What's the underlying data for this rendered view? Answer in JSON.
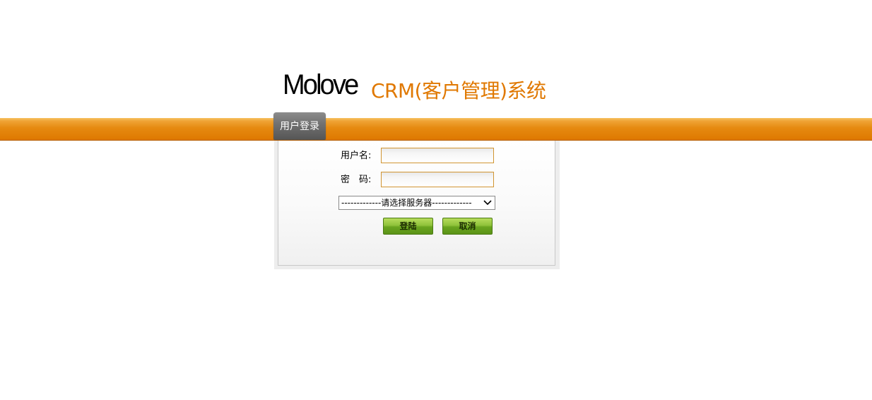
{
  "header": {
    "logo_text": "Molove",
    "app_title": "CRM(客户管理)系统"
  },
  "tab": {
    "label": "用户登录"
  },
  "form": {
    "username_label": "用户名:",
    "username_value": "",
    "password_label": "密　码:",
    "password_value": "",
    "server_select_value": "-------------请选择服务器-------------",
    "login_button": "登陆",
    "cancel_button": "取消"
  },
  "colors": {
    "brand_orange": "#e07800",
    "band_orange": "#e68a10",
    "tab_gray": "#727272",
    "button_green": "#8fc23a"
  },
  "icons": {
    "select_arrow": "chevron-down-icon"
  }
}
